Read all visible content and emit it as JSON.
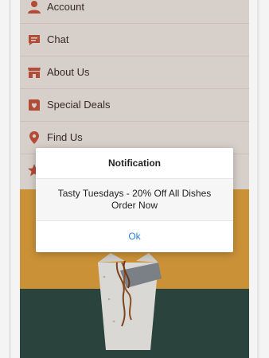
{
  "menu": {
    "items": [
      {
        "label": "Account",
        "icon": "person-icon"
      },
      {
        "label": "Chat",
        "icon": "chat-bubble-icon"
      },
      {
        "label": "About Us",
        "icon": "storefront-icon"
      },
      {
        "label": "Special Deals",
        "icon": "heart-tag-icon"
      },
      {
        "label": "Find Us",
        "icon": "map-pin-icon"
      },
      {
        "label": "",
        "icon": "star-icon"
      }
    ],
    "accent_color": "#c8553d"
  },
  "dialog": {
    "title": "Notification",
    "message_line1": "Tasty Tuesdays - 20% Off All Dishes",
    "message_line2": "Order Now",
    "ok_label": "Ok"
  }
}
